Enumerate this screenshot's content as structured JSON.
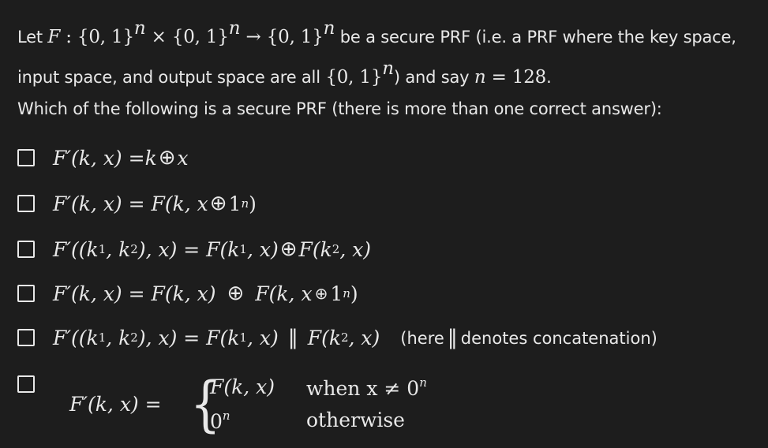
{
  "intro": {
    "let": "Let",
    "sig_F": "F",
    "sig_colon": " : ",
    "sig_set": "{0, 1}",
    "sig_n": "n",
    "sig_times": " × ",
    "sig_arrow": " → ",
    "text_mid": " be a secure PRF (i.e. a PRF where the key space, input space, and output space are all ",
    "text_and": ") and say ",
    "n_var": "n",
    "n_eq": " = 128",
    "text_end": "."
  },
  "question": "Which of the following is a secure PRF (there is more than one correct answer):",
  "options": {
    "opt1": {
      "lhs": "F′(k, x) = ",
      "k": "k",
      "x": "x"
    },
    "opt2": {
      "lhs": "F′(k, x) = F(k, x",
      "rhs": "1",
      "sup": "n",
      "close": ")"
    },
    "opt3": {
      "lhs": "F′((k",
      "sub1": "1",
      "mid1": ", k",
      "sub2": "2",
      "mid2": "), x) = F(k",
      "sub3": "1",
      "mid3": ", x)",
      "rhs": "F(k",
      "sub4": "2",
      "end": ", x)"
    },
    "opt4": {
      "lhs": "F′(k, x) = F(k, x)",
      "rhs": "F(k, x",
      "one": "1",
      "sup": "n",
      "close": ")"
    },
    "opt5": {
      "lhs": "F′((k",
      "sub1": "1",
      "mid1": ", k",
      "sub2": "2",
      "mid2": "), x) = F(k",
      "sub3": "1",
      "mid3": ", x)",
      "rhs": "F(k",
      "sub4": "2",
      "end": ", x)",
      "note_open": "(here",
      "note_close": "denotes concatenation)"
    },
    "opt6": {
      "lhs": "F′(k, x) =",
      "case1": "F(k, x)",
      "case2_base": "0",
      "case2_sup": "n",
      "cond1": "when x ≠ 0",
      "cond1_sup": "n",
      "cond2": "otherwise"
    }
  }
}
